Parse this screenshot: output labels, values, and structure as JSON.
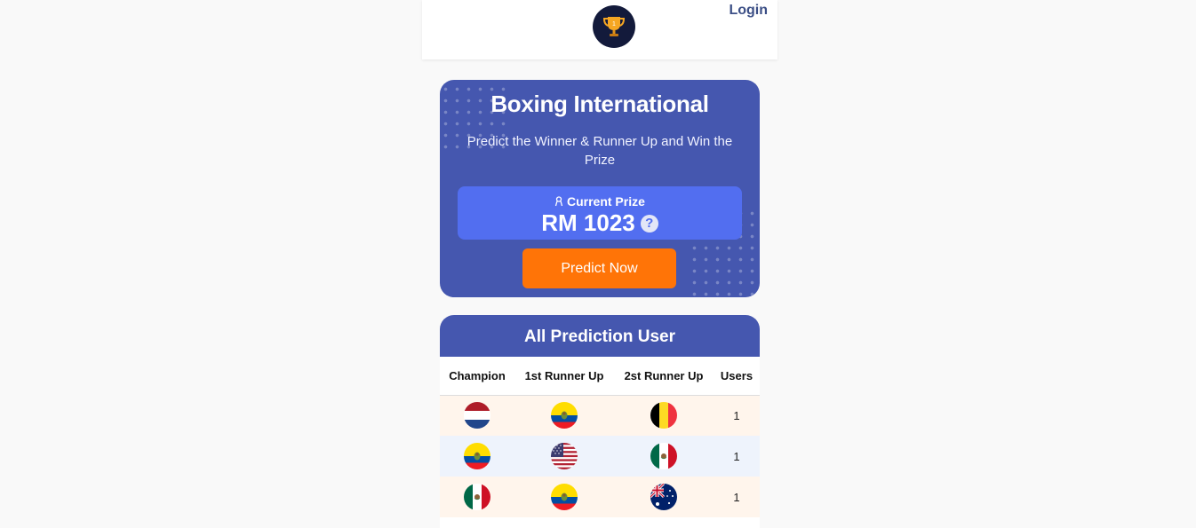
{
  "header": {
    "logo_icon": "trophy-icon",
    "login_label": "Login"
  },
  "hero": {
    "title": "Boxing International",
    "subtitle": "Predict the Winner & Runner Up and Win the Prize",
    "prize_icon": "ribbon-icon",
    "prize_label": "Current Prize",
    "prize_amount": "RM 1023",
    "help_icon": "question-circle-icon",
    "cta_label": "Predict Now"
  },
  "predictions": {
    "title": "All Prediction User",
    "columns": [
      "Champion",
      "1st Runner Up",
      "2st Runner Up",
      "Users"
    ],
    "rows": [
      {
        "champion": "netherlands-flag-icon",
        "runner_up_1": "ecuador-flag-icon",
        "runner_up_2": "belgium-flag-icon",
        "users": "1"
      },
      {
        "champion": "ecuador-flag-icon",
        "runner_up_1": "usa-flag-icon",
        "runner_up_2": "mexico-flag-icon",
        "users": "1"
      },
      {
        "champion": "mexico-flag-icon",
        "runner_up_1": "ecuador-flag-icon",
        "runner_up_2": "australia-flag-icon",
        "users": "1"
      }
    ]
  },
  "colors": {
    "primary": "#4557af",
    "prize_box": "#526ef0",
    "cta": "#ff7407",
    "row_alt_1": "#fff5ec",
    "row_alt_2": "#eef3fc"
  }
}
